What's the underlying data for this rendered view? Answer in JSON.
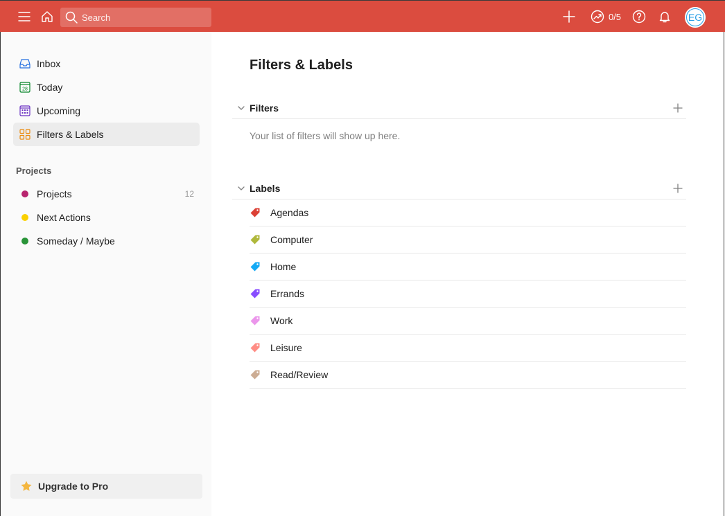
{
  "topbar": {
    "search_placeholder": "Search",
    "karma": "0/5",
    "avatar_initials": "EG",
    "accent": "#db4c3f"
  },
  "sidebar": {
    "nav": [
      {
        "label": "Inbox",
        "icon": "inbox-icon",
        "color": "#246fe0"
      },
      {
        "label": "Today",
        "icon": "calendar-today-icon",
        "color": "#058527"
      },
      {
        "label": "Upcoming",
        "icon": "calendar-upcoming-icon",
        "color": "#692fc2"
      },
      {
        "label": "Filters & Labels",
        "icon": "filters-labels-icon",
        "color": "#eb8909"
      }
    ],
    "projects_heading": "Projects",
    "projects": [
      {
        "name": "Projects",
        "count": "12",
        "color": "#b8256f"
      },
      {
        "name": "Next Actions",
        "count": "",
        "color": "#fad000"
      },
      {
        "name": "Someday / Maybe",
        "count": "",
        "color": "#299438"
      }
    ],
    "upgrade_label": "Upgrade to Pro"
  },
  "main": {
    "title": "Filters & Labels",
    "filters": {
      "heading": "Filters",
      "empty_text": "Your list of filters will show up here."
    },
    "labels": {
      "heading": "Labels",
      "items": [
        {
          "name": "Agendas",
          "color": "#db4035"
        },
        {
          "name": "Computer",
          "color": "#afb83b"
        },
        {
          "name": "Home",
          "color": "#14aaf5"
        },
        {
          "name": "Errands",
          "color": "#884dff"
        },
        {
          "name": "Work",
          "color": "#eb96eb"
        },
        {
          "name": "Leisure",
          "color": "#ff8d85"
        },
        {
          "name": "Read/Review",
          "color": "#ccac93"
        }
      ]
    }
  }
}
